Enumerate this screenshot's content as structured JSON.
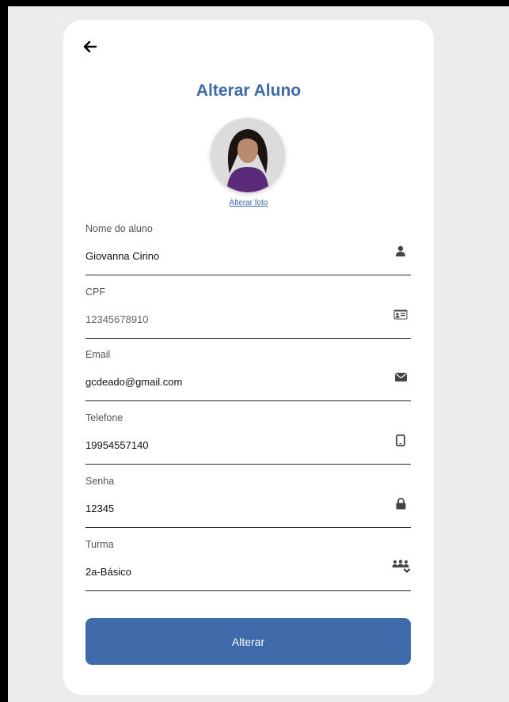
{
  "page": {
    "title": "Alterar Aluno",
    "change_photo_label": "Alterar foto",
    "submit_label": "Alterar"
  },
  "fields": {
    "name": {
      "label": "Nome do aluno",
      "value": "Giovanna Cirino",
      "icon": "person-icon"
    },
    "cpf": {
      "label": "CPF",
      "value": "12345678910",
      "icon": "id-card-icon"
    },
    "email": {
      "label": "Email",
      "value": "gcdeado@gmail.com",
      "icon": "envelope-icon"
    },
    "phone": {
      "label": "Telefone",
      "value": "19954557140",
      "icon": "mobile-phone-icon"
    },
    "password": {
      "label": "Senha",
      "value": "12345",
      "icon": "lock-icon"
    },
    "class": {
      "label": "Turma",
      "value": "2a-Básico",
      "icon": "group-icon"
    }
  },
  "colors": {
    "accent": "#3e6aa9",
    "background": "#ececec",
    "card": "#ffffff"
  }
}
